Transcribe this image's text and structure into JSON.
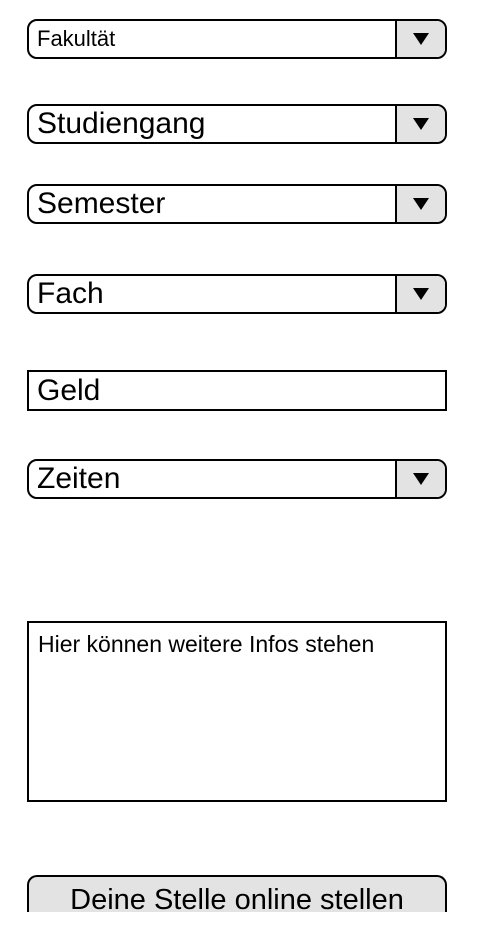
{
  "form": {
    "fakultaet": {
      "value": "Fakultät",
      "icon": "chevron-down-icon"
    },
    "studiengang": {
      "value": "Studiengang",
      "icon": "chevron-down-icon"
    },
    "semester": {
      "value": "Semester",
      "icon": "chevron-down-icon"
    },
    "fach": {
      "value": "Fach",
      "icon": "chevron-down-icon"
    },
    "geld": {
      "value": "Geld"
    },
    "zeiten": {
      "value": "Zeiten",
      "icon": "chevron-down-icon"
    },
    "infos": {
      "value": "Hier können weitere Infos stehen"
    },
    "submit_label": "Deine Stelle online stellen"
  },
  "colors": {
    "border": "#000000",
    "button_fill": "#e3e3e3",
    "background": "#ffffff"
  }
}
